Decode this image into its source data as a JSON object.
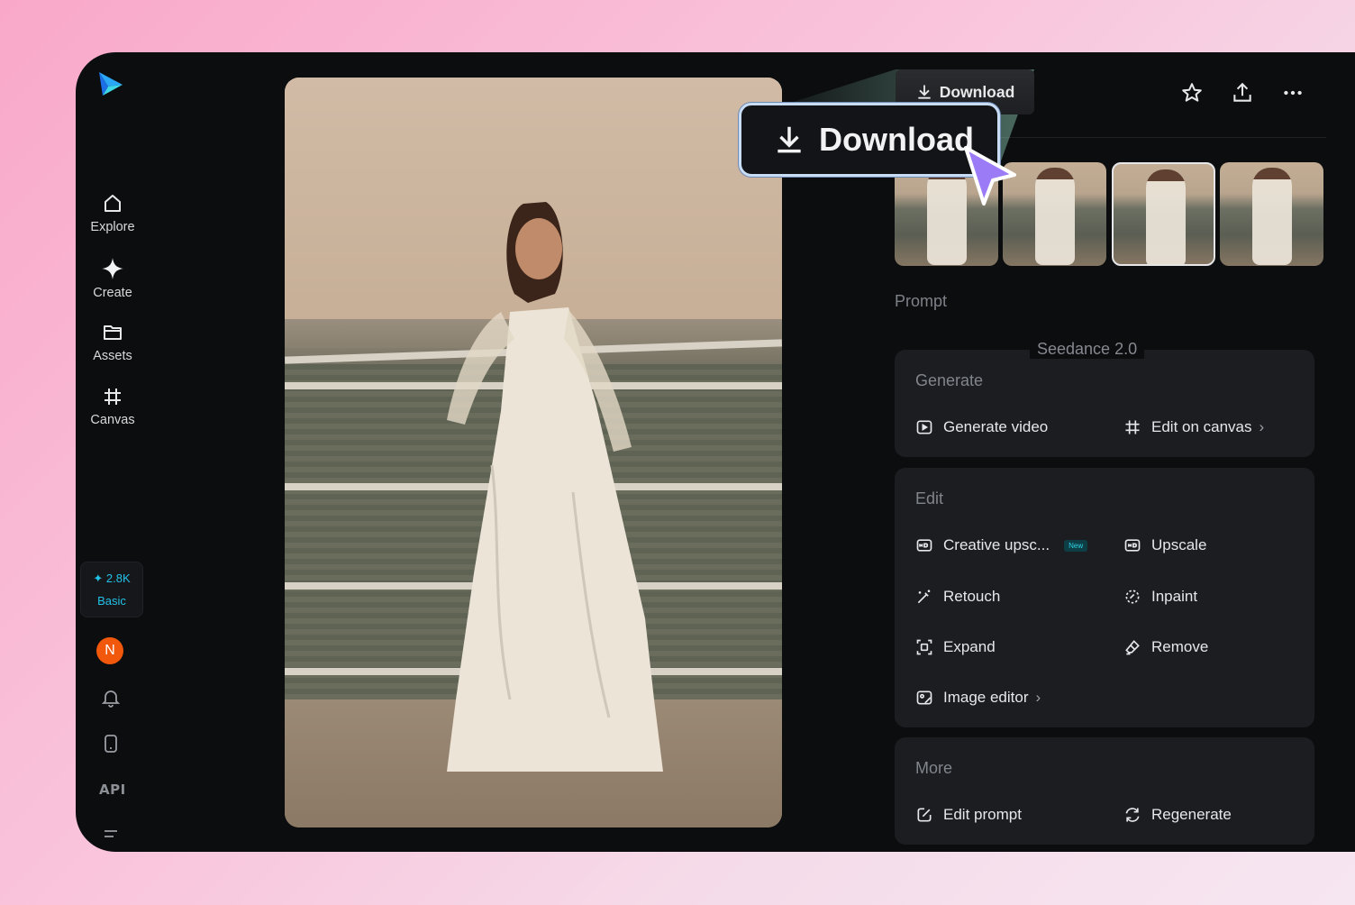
{
  "sidebar": {
    "items": [
      {
        "label": "Explore",
        "icon": "home-icon"
      },
      {
        "label": "Create",
        "icon": "sparkle-icon"
      },
      {
        "label": "Assets",
        "icon": "folder-icon"
      },
      {
        "label": "Canvas",
        "icon": "canvas-icon"
      }
    ],
    "credits": {
      "amount": "2.8K",
      "plan": "Basic"
    },
    "avatar_initial": "N",
    "api_label": "API"
  },
  "toolbar": {
    "download_small": "Download",
    "download_big": "Download"
  },
  "right_panel": {
    "prompt_label": "Prompt",
    "model_label": "Seedance 2.0",
    "generate": {
      "title": "Generate",
      "generate_video": "Generate video",
      "edit_on_canvas": "Edit on canvas"
    },
    "edit": {
      "title": "Edit",
      "creative_upscale": "Creative upsc...",
      "new_badge": "New",
      "upscale": "Upscale",
      "retouch": "Retouch",
      "inpaint": "Inpaint",
      "expand": "Expand",
      "remove": "Remove",
      "image_editor": "Image editor"
    },
    "more": {
      "title": "More",
      "edit_prompt": "Edit prompt",
      "regenerate": "Regenerate"
    }
  },
  "colors": {
    "accent_cyan": "#23c2e8",
    "avatar_orange": "#f2580c",
    "cursor_purple": "#9b7cf6",
    "panel_bg": "#0c0d0f",
    "card_bg": "#1b1d21"
  }
}
